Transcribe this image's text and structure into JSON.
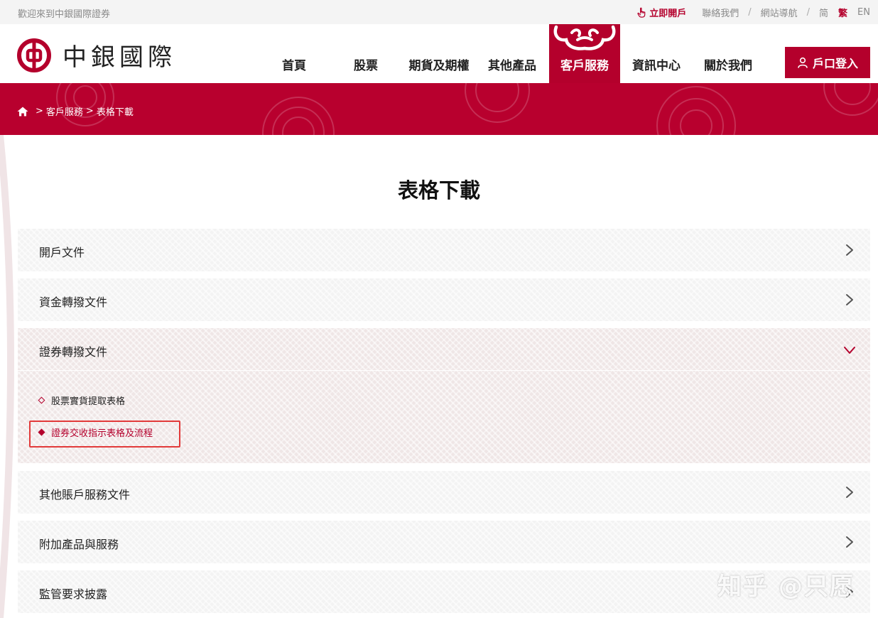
{
  "topbar": {
    "welcome": "歡迎來到中銀國際證券",
    "open_account": "立即開戶",
    "contact_us": "聯絡我們",
    "site_nav": "網站導航",
    "lang_simplified": "简",
    "lang_traditional": "繁",
    "lang_english": "EN"
  },
  "header": {
    "logo_text": "中銀國際",
    "nav": [
      {
        "label": "首頁"
      },
      {
        "label": "股票"
      },
      {
        "label": "期貨及期權"
      },
      {
        "label": "其他產品"
      },
      {
        "label": "客戶服務"
      },
      {
        "label": "資訊中心"
      },
      {
        "label": "關於我們"
      }
    ],
    "login_label": "戶口登入"
  },
  "breadcrumb": {
    "items": [
      "客戶服務",
      "表格下載"
    ]
  },
  "page": {
    "title": "表格下載"
  },
  "accordion": [
    {
      "title": "開戶文件",
      "expanded": false
    },
    {
      "title": "資金轉撥文件",
      "expanded": false
    },
    {
      "title": "證券轉撥文件",
      "expanded": true,
      "items": [
        {
          "label": "股票實貨提取表格",
          "selected": false
        },
        {
          "label": "證券交收指示表格及流程",
          "selected": true
        }
      ]
    },
    {
      "title": "其他賬戶服務文件",
      "expanded": false
    },
    {
      "title": "附加產品與服務",
      "expanded": false
    },
    {
      "title": "監管要求披露",
      "expanded": false
    }
  ],
  "watermark": "知乎 @只愿",
  "colors": {
    "brand_red": "#b4002c",
    "highlight_border": "#e23a3a",
    "panel_bg": "#f3f3f3",
    "panel_open_bg": "#efe6e6"
  }
}
